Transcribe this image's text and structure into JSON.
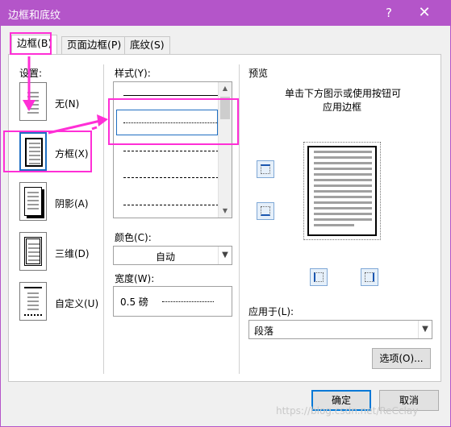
{
  "window": {
    "title": "边框和底纹",
    "help": "?",
    "close": "✕"
  },
  "tabs": [
    {
      "label": "边框(B)",
      "active": true
    },
    {
      "label": "页面边框(P)",
      "active": false
    },
    {
      "label": "底纹(S)",
      "active": false
    }
  ],
  "settings": {
    "heading": "设置:",
    "items": [
      {
        "label": "无(N)",
        "selected": false,
        "icon": "setting-none-icon"
      },
      {
        "label": "方框(X)",
        "selected": true,
        "icon": "setting-box-icon"
      },
      {
        "label": "阴影(A)",
        "selected": false,
        "icon": "setting-shadow-icon"
      },
      {
        "label": "三维(D)",
        "selected": false,
        "icon": "setting-3d-icon"
      },
      {
        "label": "自定义(U)",
        "selected": false,
        "icon": "setting-custom-icon"
      }
    ]
  },
  "style": {
    "label": "样式(Y):",
    "options": [
      "solid",
      "dotted",
      "dashed-small",
      "dashed",
      "dash-dot"
    ],
    "selected_index": 1
  },
  "color": {
    "label": "颜色(C):",
    "value": "自动"
  },
  "width": {
    "label": "宽度(W):",
    "value": "0.5 磅"
  },
  "preview": {
    "heading": "预览",
    "instructions_line1": "单击下方图示或使用按钮可",
    "instructions_line2": "应用边框"
  },
  "apply_to": {
    "label": "应用于(L):",
    "value": "段落"
  },
  "buttons": {
    "options": "选项(O)...",
    "ok": "确定",
    "cancel": "取消"
  },
  "watermark": "https://blog.csdn.net/ReCclay",
  "colors": {
    "titlebar": "#b455c9",
    "highlight": "#ff2fd6",
    "focus": "#0078d7"
  }
}
